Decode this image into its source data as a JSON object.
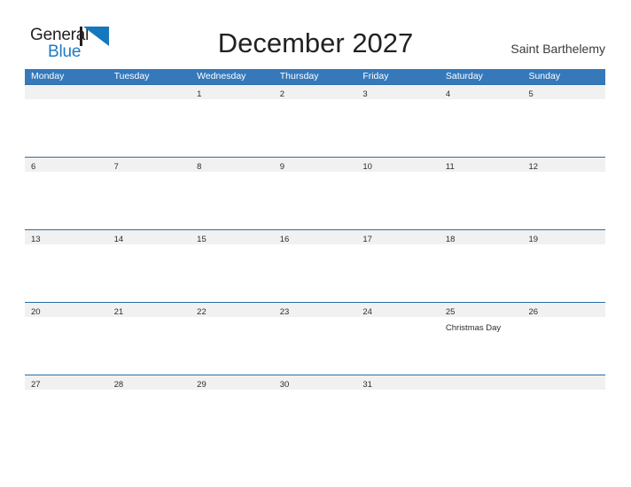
{
  "header": {
    "logo": {
      "word_top": "General",
      "word_bottom": "Blue",
      "mark_name": "general-blue-triangle-logo"
    },
    "title": "December 2027",
    "location": "Saint Barthelemy"
  },
  "colors": {
    "header_blue": "#3579bb",
    "row_divider_blue": "#2b6ca6",
    "date_band_gray": "#f1f1f1",
    "logo_blue": "#1e7ac2",
    "text_dark": "#231f20"
  },
  "calendar": {
    "weekdays": [
      "Monday",
      "Tuesday",
      "Wednesday",
      "Thursday",
      "Friday",
      "Saturday",
      "Sunday"
    ],
    "weeks": [
      {
        "days": [
          {
            "number": "",
            "event": ""
          },
          {
            "number": "",
            "event": ""
          },
          {
            "number": "1",
            "event": ""
          },
          {
            "number": "2",
            "event": ""
          },
          {
            "number": "3",
            "event": ""
          },
          {
            "number": "4",
            "event": ""
          },
          {
            "number": "5",
            "event": ""
          }
        ]
      },
      {
        "days": [
          {
            "number": "6",
            "event": ""
          },
          {
            "number": "7",
            "event": ""
          },
          {
            "number": "8",
            "event": ""
          },
          {
            "number": "9",
            "event": ""
          },
          {
            "number": "10",
            "event": ""
          },
          {
            "number": "11",
            "event": ""
          },
          {
            "number": "12",
            "event": ""
          }
        ]
      },
      {
        "days": [
          {
            "number": "13",
            "event": ""
          },
          {
            "number": "14",
            "event": ""
          },
          {
            "number": "15",
            "event": ""
          },
          {
            "number": "16",
            "event": ""
          },
          {
            "number": "17",
            "event": ""
          },
          {
            "number": "18",
            "event": ""
          },
          {
            "number": "19",
            "event": ""
          }
        ]
      },
      {
        "days": [
          {
            "number": "20",
            "event": ""
          },
          {
            "number": "21",
            "event": ""
          },
          {
            "number": "22",
            "event": ""
          },
          {
            "number": "23",
            "event": ""
          },
          {
            "number": "24",
            "event": ""
          },
          {
            "number": "25",
            "event": "Christmas Day"
          },
          {
            "number": "26",
            "event": ""
          }
        ]
      },
      {
        "days": [
          {
            "number": "27",
            "event": ""
          },
          {
            "number": "28",
            "event": ""
          },
          {
            "number": "29",
            "event": ""
          },
          {
            "number": "30",
            "event": ""
          },
          {
            "number": "31",
            "event": ""
          },
          {
            "number": "",
            "event": ""
          },
          {
            "number": "",
            "event": ""
          }
        ]
      }
    ]
  }
}
